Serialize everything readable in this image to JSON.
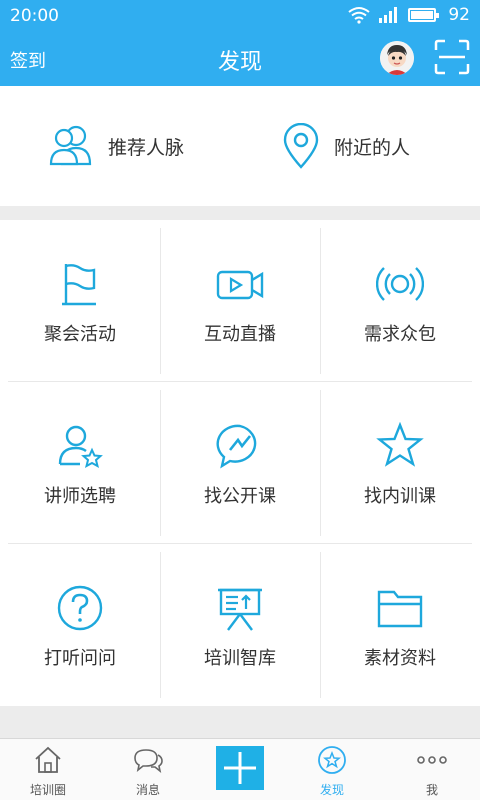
{
  "status_bar": {
    "time": "20:00",
    "battery": "92"
  },
  "nav": {
    "checkin": "签到",
    "title": "发现"
  },
  "top_items": [
    {
      "label": "推荐人脉",
      "icon": "users-icon"
    },
    {
      "label": "附近的人",
      "icon": "location-pin-icon"
    }
  ],
  "grid": [
    {
      "label": "聚会活动",
      "icon": "flag-icon"
    },
    {
      "label": "互动直播",
      "icon": "video-camera-icon"
    },
    {
      "label": "需求众包",
      "icon": "broadcast-icon"
    },
    {
      "label": "讲师选聘",
      "icon": "user-star-icon"
    },
    {
      "label": "找公开课",
      "icon": "chat-lightning-icon"
    },
    {
      "label": "找内训课",
      "icon": "star-icon"
    },
    {
      "label": "打听问问",
      "icon": "question-icon"
    },
    {
      "label": "培训智库",
      "icon": "presentation-icon"
    },
    {
      "label": "素材资料",
      "icon": "folder-icon"
    }
  ],
  "tabs": [
    {
      "label": "培训圈",
      "icon": "home-icon"
    },
    {
      "label": "消息",
      "icon": "chat-bubbles-icon"
    },
    {
      "label": "",
      "icon": "plus-icon"
    },
    {
      "label": "发现",
      "icon": "discover-star-icon",
      "active": true
    },
    {
      "label": "我",
      "icon": "more-dots-icon"
    }
  ],
  "colors": {
    "accent": "#30aef0",
    "icon": "#1ea8dc"
  }
}
